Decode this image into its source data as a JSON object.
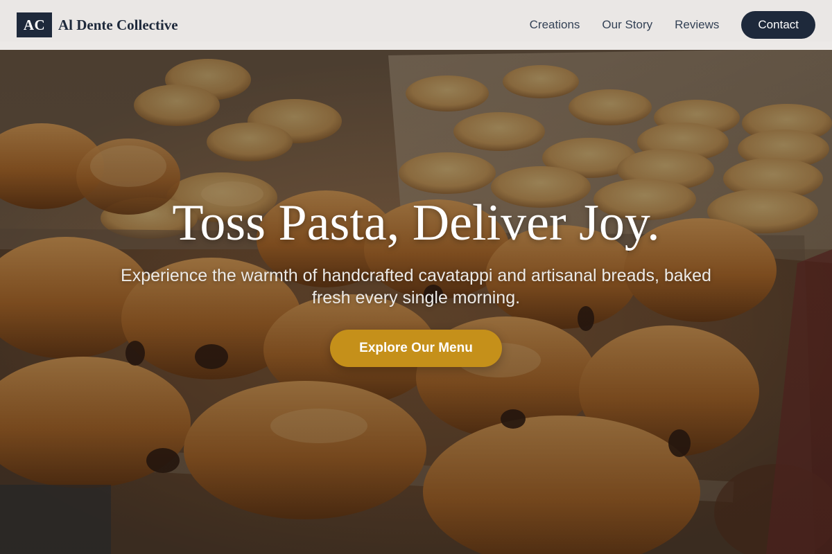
{
  "brand": {
    "logo_text": "AC",
    "name": "Al Dente Collective"
  },
  "nav": {
    "links": [
      "Creations",
      "Our Story",
      "Reviews"
    ],
    "contact_label": "Contact"
  },
  "hero": {
    "title": "Toss Pasta, Deliver Joy.",
    "subtitle": "Experience the warmth of handcrafted cavatappi and artisanal breads, baked fresh every single morning.",
    "cta_label": "Explore Our Menu"
  },
  "colors": {
    "navy": "#1e293b",
    "accent_gold": "#c5901a",
    "header_bg": "#f6f4f2"
  }
}
